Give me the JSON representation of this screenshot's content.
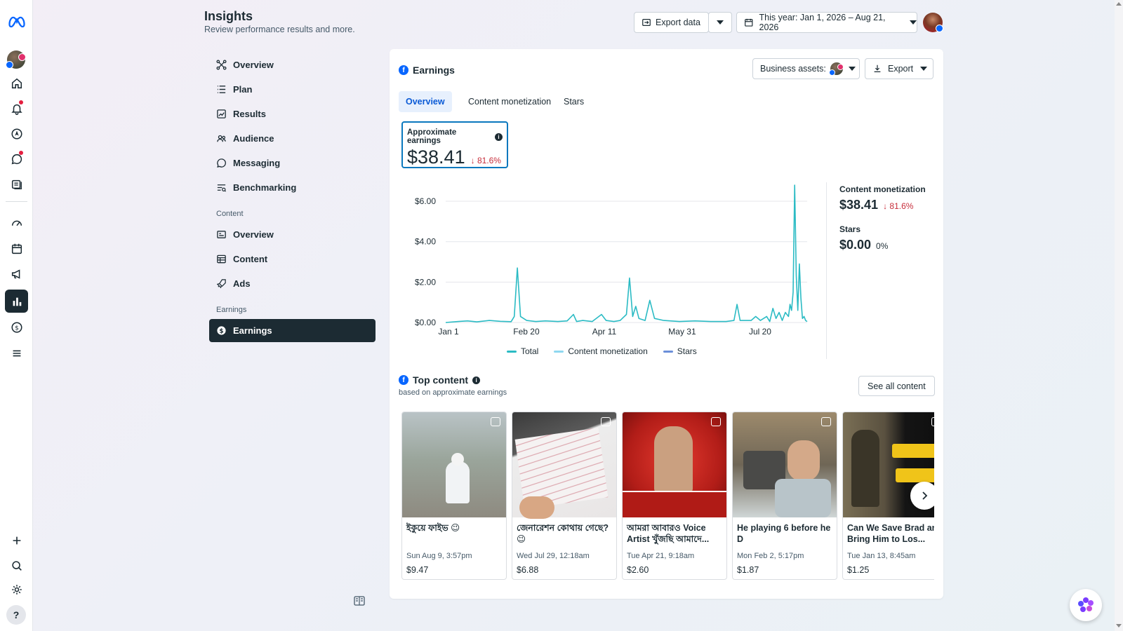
{
  "header": {
    "title": "Insights",
    "subtitle": "Review performance results and more.",
    "export_data_label": "Export data",
    "date_range_label": "This year: Jan 1, 2026 – Aug 21, 2026"
  },
  "sidebar": {
    "items": [
      {
        "label": "Overview",
        "icon": "overview-icon"
      },
      {
        "label": "Plan",
        "icon": "plan-icon"
      },
      {
        "label": "Results",
        "icon": "results-icon"
      },
      {
        "label": "Audience",
        "icon": "audience-icon"
      },
      {
        "label": "Messaging",
        "icon": "messaging-icon"
      },
      {
        "label": "Benchmarking",
        "icon": "benchmarking-icon"
      }
    ],
    "content_section_label": "Content",
    "content_items": [
      {
        "label": "Overview",
        "icon": "content-overview-icon"
      },
      {
        "label": "Content",
        "icon": "content-table-icon"
      },
      {
        "label": "Ads",
        "icon": "rocket-icon"
      }
    ],
    "earnings_section_label": "Earnings",
    "earnings_item": {
      "label": "Earnings",
      "icon": "dollar-icon"
    }
  },
  "card": {
    "title": "Earnings",
    "business_assets_label": "Business assets:",
    "export_label": "Export",
    "tabs": [
      "Overview",
      "Content monetization",
      "Stars"
    ],
    "active_tab": "Overview",
    "approx_label": "Approximate earnings",
    "approx_value": "$38.41",
    "approx_delta": "81.6%",
    "side_metrics": [
      {
        "label": "Content monetization",
        "value": "$38.41",
        "delta": "81.6%",
        "direction": "down"
      },
      {
        "label": "Stars",
        "value": "$0.00",
        "delta": "0%",
        "direction": "flat"
      }
    ],
    "legend": [
      "Total",
      "Content monetization",
      "Stars"
    ],
    "top_content_title": "Top content",
    "top_content_subtitle": "based on approximate earnings",
    "see_all_label": "See all content",
    "tiles": [
      {
        "title": "ইকুয়ে ফাইভ 😉",
        "date": "Sun Aug 9, 3:57pm",
        "earnings": "$9.47",
        "type": "video-icon"
      },
      {
        "title": "জেনারেশন কোথায় গেছে? 😉",
        "date": "Wed Jul 29, 12:18am",
        "earnings": "$6.88",
        "type": "reel-icon"
      },
      {
        "title": "আমরা আবারও Voice Artist খুঁজছি আমাদে...",
        "date": "Tue Apr 21, 9:18am",
        "earnings": "$2.60",
        "type": "photo-icon"
      },
      {
        "title": "He playing 6 before he D",
        "date": "Mon Feb 2, 5:17pm",
        "earnings": "$1.87",
        "type": "photo-icon"
      },
      {
        "title": "Can We Save Brad and Bring Him to Los...",
        "date": "Tue Jan 13, 8:45am",
        "earnings": "$1.25",
        "type": "reel-icon"
      }
    ]
  },
  "chart_data": {
    "type": "line",
    "title": "",
    "xlabel": "",
    "ylabel": "",
    "x_ticks": [
      "Jan 1",
      "Feb 20",
      "Apr 11",
      "May 31",
      "Jul 20"
    ],
    "y_ticks": [
      "$0.00",
      "$2.00",
      "$4.00",
      "$6.00"
    ],
    "ylim": [
      0,
      6.8
    ],
    "x_range_days": [
      0,
      232
    ],
    "grid": true,
    "legend_position": "bottom",
    "series": [
      {
        "name": "Total",
        "color": "#2bbbc4",
        "points": [
          [
            0,
            0
          ],
          [
            8,
            0.05
          ],
          [
            14,
            0.08
          ],
          [
            20,
            0.03
          ],
          [
            28,
            0.1
          ],
          [
            35,
            0.06
          ],
          [
            42,
            0.04
          ],
          [
            44,
            0.3
          ],
          [
            46,
            2.7
          ],
          [
            48,
            0.3
          ],
          [
            52,
            0.1
          ],
          [
            58,
            0.05
          ],
          [
            64,
            0.08
          ],
          [
            72,
            0.05
          ],
          [
            78,
            0.08
          ],
          [
            82,
            0.4
          ],
          [
            84,
            0.05
          ],
          [
            88,
            0.1
          ],
          [
            94,
            0.05
          ],
          [
            100,
            0.4
          ],
          [
            103,
            0.1
          ],
          [
            108,
            0.05
          ],
          [
            112,
            0.1
          ],
          [
            116,
            0.4
          ],
          [
            118,
            2.2
          ],
          [
            120,
            0.3
          ],
          [
            122,
            0.8
          ],
          [
            124,
            0.2
          ],
          [
            128,
            0.1
          ],
          [
            131,
            1.1
          ],
          [
            134,
            0.2
          ],
          [
            140,
            0.1
          ],
          [
            150,
            0.05
          ],
          [
            160,
            0.08
          ],
          [
            170,
            0.05
          ],
          [
            180,
            0.05
          ],
          [
            185,
            0.1
          ],
          [
            187,
            0.9
          ],
          [
            189,
            0.1
          ],
          [
            196,
            0.1
          ],
          [
            199,
            0.3
          ],
          [
            202,
            0.1
          ],
          [
            206,
            0.3
          ],
          [
            208,
            0.05
          ],
          [
            210,
            0.7
          ],
          [
            212,
            0.2
          ],
          [
            214,
            0.5
          ],
          [
            216,
            0.1
          ],
          [
            218,
            0.5
          ],
          [
            220,
            0.3
          ],
          [
            221,
            0.9
          ],
          [
            222,
            0.6
          ],
          [
            223,
            1.5
          ],
          [
            224,
            6.8
          ],
          [
            225,
            2.3
          ],
          [
            226,
            0.6
          ],
          [
            227,
            2.9
          ],
          [
            228,
            1.2
          ],
          [
            229,
            0.2
          ],
          [
            230,
            0.3
          ],
          [
            231,
            0.1
          ],
          [
            232,
            0.05
          ]
        ]
      },
      {
        "name": "Content monetization",
        "color": "#8fd8f0",
        "points": []
      },
      {
        "name": "Stars",
        "color": "#6b8fd9",
        "points": []
      }
    ]
  },
  "colors": {
    "accent": "#0866ff",
    "active_nav": "#1c2b33",
    "line": "#2bbbc4",
    "negative": "#c72e3b"
  }
}
